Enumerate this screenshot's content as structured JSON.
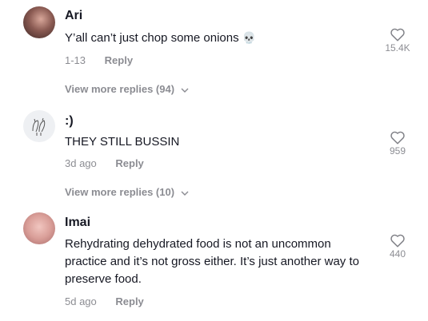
{
  "comments": [
    {
      "author": "Ari",
      "text": "Y’all can’t just chop some onions",
      "emoji": "💀",
      "date": "1-13",
      "reply_label": "Reply",
      "likes": "15.4K",
      "more_replies": "View more replies (94)"
    },
    {
      "author": ":)",
      "text": "THEY STILL BUSSIN",
      "date": "3d ago",
      "reply_label": "Reply",
      "likes": "959",
      "more_replies": "View more replies (10)"
    },
    {
      "author": "Imai",
      "text_lines": [
        "Rehydrating dehydrated food is not an uncommon",
        "practice and it’s not gross either. It’s just another way to",
        "preserve food."
      ],
      "date": "5d ago",
      "reply_label": "Reply",
      "likes": "440"
    }
  ]
}
